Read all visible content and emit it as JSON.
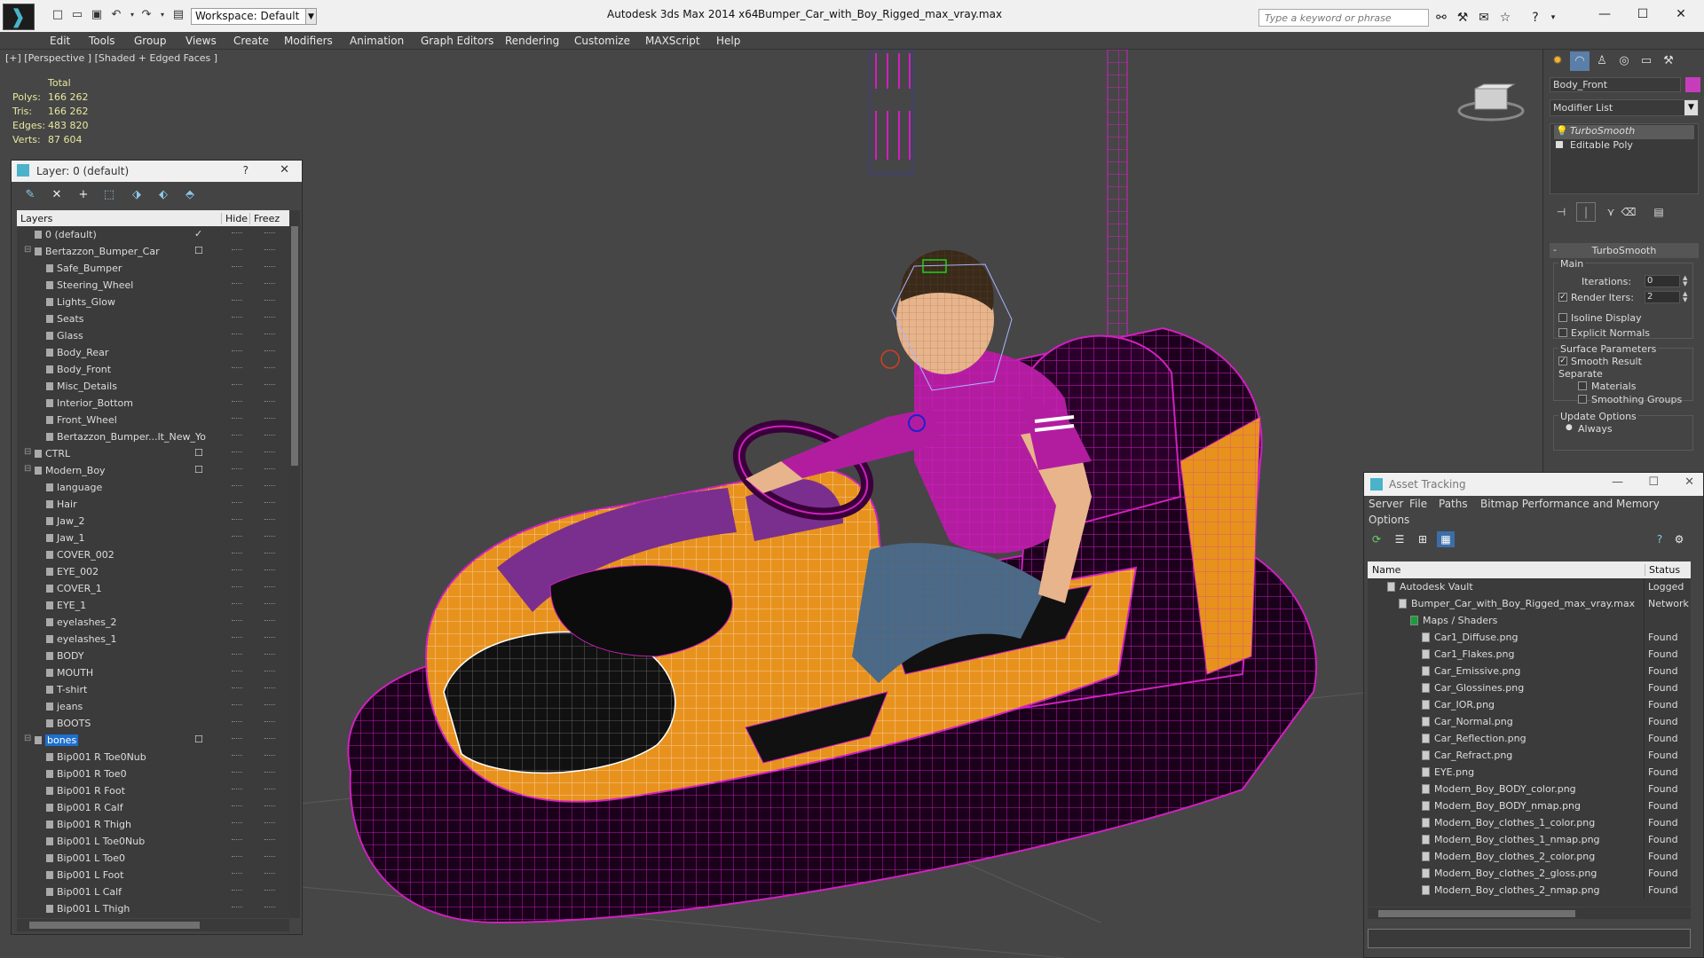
{
  "titlebar": {
    "workspace": "Workspace: Default",
    "app": "Autodesk 3ds Max  2014 x64",
    "file": "Bumper_Car_with_Boy_Rigged_max_vray.max",
    "search_placeholder": "Type a keyword or phrase"
  },
  "menu": [
    "Edit",
    "Tools",
    "Group",
    "Views",
    "Create",
    "Modifiers",
    "Animation",
    "Graph Editors",
    "Rendering",
    "Customize",
    "MAXScript",
    "Help"
  ],
  "viewport": {
    "label": "[+] [Perspective ] [Shaded + Edged Faces ]",
    "stats": {
      "header": "Total",
      "rows": [
        {
          "k": "Polys:",
          "v": "166 262"
        },
        {
          "k": "Tris:",
          "v": "166 262"
        },
        {
          "k": "Edges:",
          "v": "483 820"
        },
        {
          "k": "Verts:",
          "v": "87 604"
        }
      ]
    },
    "colors": {
      "body": "#e8921e",
      "stripe": "#7a2f8e",
      "wire": "#d020c0",
      "shirt": "#b21da0",
      "jeans": "#4a6a8a",
      "skin": "#e8b48c"
    }
  },
  "layer_explorer": {
    "title": "Layer: 0 (default)",
    "col_layers": "Layers",
    "col_hide": "Hide",
    "col_freeze": "Freez",
    "rows": [
      {
        "name": "0 (default)",
        "level": 0,
        "current": true
      },
      {
        "name": "Bertazzon_Bumper_Car",
        "level": 0,
        "toggle": true,
        "box": true
      },
      {
        "name": "Safe_Bumper",
        "level": 1
      },
      {
        "name": "Steering_Wheel",
        "level": 1
      },
      {
        "name": "Lights_Glow",
        "level": 1
      },
      {
        "name": "Seats",
        "level": 1
      },
      {
        "name": "Glass",
        "level": 1
      },
      {
        "name": "Body_Rear",
        "level": 1
      },
      {
        "name": "Body_Front",
        "level": 1
      },
      {
        "name": "Misc_Details",
        "level": 1
      },
      {
        "name": "Interior_Bottom",
        "level": 1
      },
      {
        "name": "Front_Wheel",
        "level": 1
      },
      {
        "name": "Bertazzon_Bumper...lt_New_Yo",
        "level": 1
      },
      {
        "name": "CTRL",
        "level": 0,
        "toggle": true,
        "box": true
      },
      {
        "name": "Modern_Boy",
        "level": 0,
        "toggle": true,
        "box": true
      },
      {
        "name": "language",
        "level": 1
      },
      {
        "name": "Hair",
        "level": 1
      },
      {
        "name": "Jaw_2",
        "level": 1
      },
      {
        "name": "Jaw_1",
        "level": 1
      },
      {
        "name": "COVER_002",
        "level": 1
      },
      {
        "name": "EYE_002",
        "level": 1
      },
      {
        "name": "COVER_1",
        "level": 1
      },
      {
        "name": "EYE_1",
        "level": 1
      },
      {
        "name": "eyelashes_2",
        "level": 1
      },
      {
        "name": "eyelashes_1",
        "level": 1
      },
      {
        "name": "BODY",
        "level": 1
      },
      {
        "name": "MOUTH",
        "level": 1
      },
      {
        "name": "T-shirt",
        "level": 1
      },
      {
        "name": "jeans",
        "level": 1
      },
      {
        "name": "BOOTS",
        "level": 1
      },
      {
        "name": "bones",
        "level": 0,
        "toggle": true,
        "box": true,
        "selected": true
      },
      {
        "name": "Bip001 R Toe0Nub",
        "level": 1
      },
      {
        "name": "Bip001 R Toe0",
        "level": 1
      },
      {
        "name": "Bip001 R Foot",
        "level": 1
      },
      {
        "name": "Bip001 R Calf",
        "level": 1
      },
      {
        "name": "Bip001 R Thigh",
        "level": 1
      },
      {
        "name": "Bip001 L Toe0Nub",
        "level": 1
      },
      {
        "name": "Bip001 L Toe0",
        "level": 1
      },
      {
        "name": "Bip001 L Foot",
        "level": 1
      },
      {
        "name": "Bip001 L Calf",
        "level": 1
      },
      {
        "name": "Bip001 L Thigh",
        "level": 1
      }
    ]
  },
  "command_panel": {
    "object_name": "Body_Front",
    "object_color": "#c63dbb",
    "modifier_list": "Modifier List",
    "stack": [
      "TurboSmooth",
      "Editable Poly"
    ],
    "turbosmooth": {
      "title": "TurboSmooth",
      "main": "Main",
      "iterations_label": "Iterations:",
      "iterations": "0",
      "render_iters_label": "Render Iters:",
      "render_iters": "2",
      "isoline": "Isoline Display",
      "explicit_normals": "Explicit Normals",
      "surface_params": "Surface Parameters",
      "smooth_result": "Smooth Result",
      "separate": "Separate",
      "materials": "Materials",
      "smoothing_groups": "Smoothing Groups",
      "update_options": "Update Options",
      "always": "Always"
    }
  },
  "asset_tracking": {
    "title": "Asset Tracking",
    "menu": [
      "Server",
      "File",
      "Paths",
      "Bitmap Performance and Memory",
      "Options"
    ],
    "col_name": "Name",
    "col_status": "Status",
    "rows": [
      {
        "name": "Autodesk Vault",
        "level": 0,
        "status": "Logged",
        "type": "vault"
      },
      {
        "name": "Bumper_Car_with_Boy_Rigged_max_vray.max",
        "level": 1,
        "status": "Network",
        "type": "max"
      },
      {
        "name": "Maps / Shaders",
        "level": 2,
        "status": "",
        "type": "maps"
      },
      {
        "name": "Car1_Diffuse.png",
        "level": 3,
        "status": "Found"
      },
      {
        "name": "Car1_Flakes.png",
        "level": 3,
        "status": "Found"
      },
      {
        "name": "Car_Emissive.png",
        "level": 3,
        "status": "Found"
      },
      {
        "name": "Car_Glossines.png",
        "level": 3,
        "status": "Found"
      },
      {
        "name": "Car_IOR.png",
        "level": 3,
        "status": "Found"
      },
      {
        "name": "Car_Normal.png",
        "level": 3,
        "status": "Found"
      },
      {
        "name": "Car_Reflection.png",
        "level": 3,
        "status": "Found"
      },
      {
        "name": "Car_Refract.png",
        "level": 3,
        "status": "Found"
      },
      {
        "name": "EYE.png",
        "level": 3,
        "status": "Found"
      },
      {
        "name": "Modern_Boy_BODY_color.png",
        "level": 3,
        "status": "Found"
      },
      {
        "name": "Modern_Boy_BODY_nmap.png",
        "level": 3,
        "status": "Found"
      },
      {
        "name": "Modern_Boy_clothes_1_color.png",
        "level": 3,
        "status": "Found"
      },
      {
        "name": "Modern_Boy_clothes_1_nmap.png",
        "level": 3,
        "status": "Found"
      },
      {
        "name": "Modern_Boy_clothes_2_color.png",
        "level": 3,
        "status": "Found"
      },
      {
        "name": "Modern_Boy_clothes_2_gloss.png",
        "level": 3,
        "status": "Found"
      },
      {
        "name": "Modern_Boy_clothes_2_nmap.png",
        "level": 3,
        "status": "Found"
      }
    ]
  }
}
